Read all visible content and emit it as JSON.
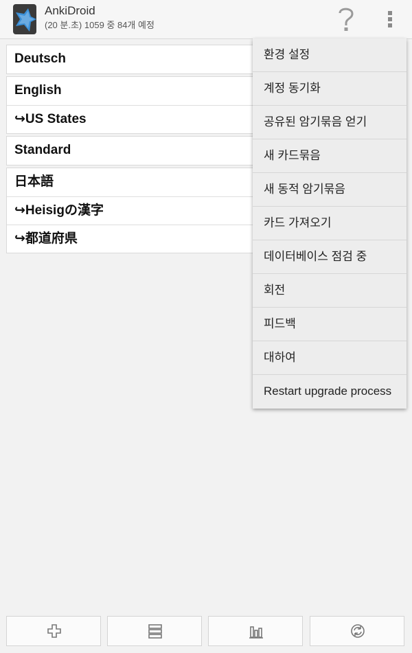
{
  "header": {
    "title": "AnkiDroid",
    "subtitle": "(20 분.초) 1059 중 84개 예정",
    "icons": [
      "app-icon",
      "help-icon",
      "overflow-menu-icon"
    ]
  },
  "decks": {
    "group1": [
      "Deutsch"
    ],
    "group2": [
      "English",
      "↪US States"
    ],
    "group3": [
      "Standard"
    ],
    "group4": [
      "日本語",
      "↪Heisigの漢字",
      "↪都道府県"
    ]
  },
  "menu": {
    "items": [
      "환경 설정",
      "계정 동기화",
      "공유된 암기묶음 얻기",
      "새 카드묶음",
      "새 동적 암기묶음",
      "카드 가져오기",
      "데이터베이스 점검 중",
      "회전",
      "피드백",
      "대하여",
      "Restart upgrade process"
    ]
  },
  "bottom_bar": {
    "icons": [
      "add-icon",
      "list-icon",
      "statistics-icon",
      "sync-icon"
    ]
  },
  "colors": {
    "background": "#f2f2f2",
    "menu_background": "#ededed",
    "icon_blue": "#3a8fd8"
  }
}
